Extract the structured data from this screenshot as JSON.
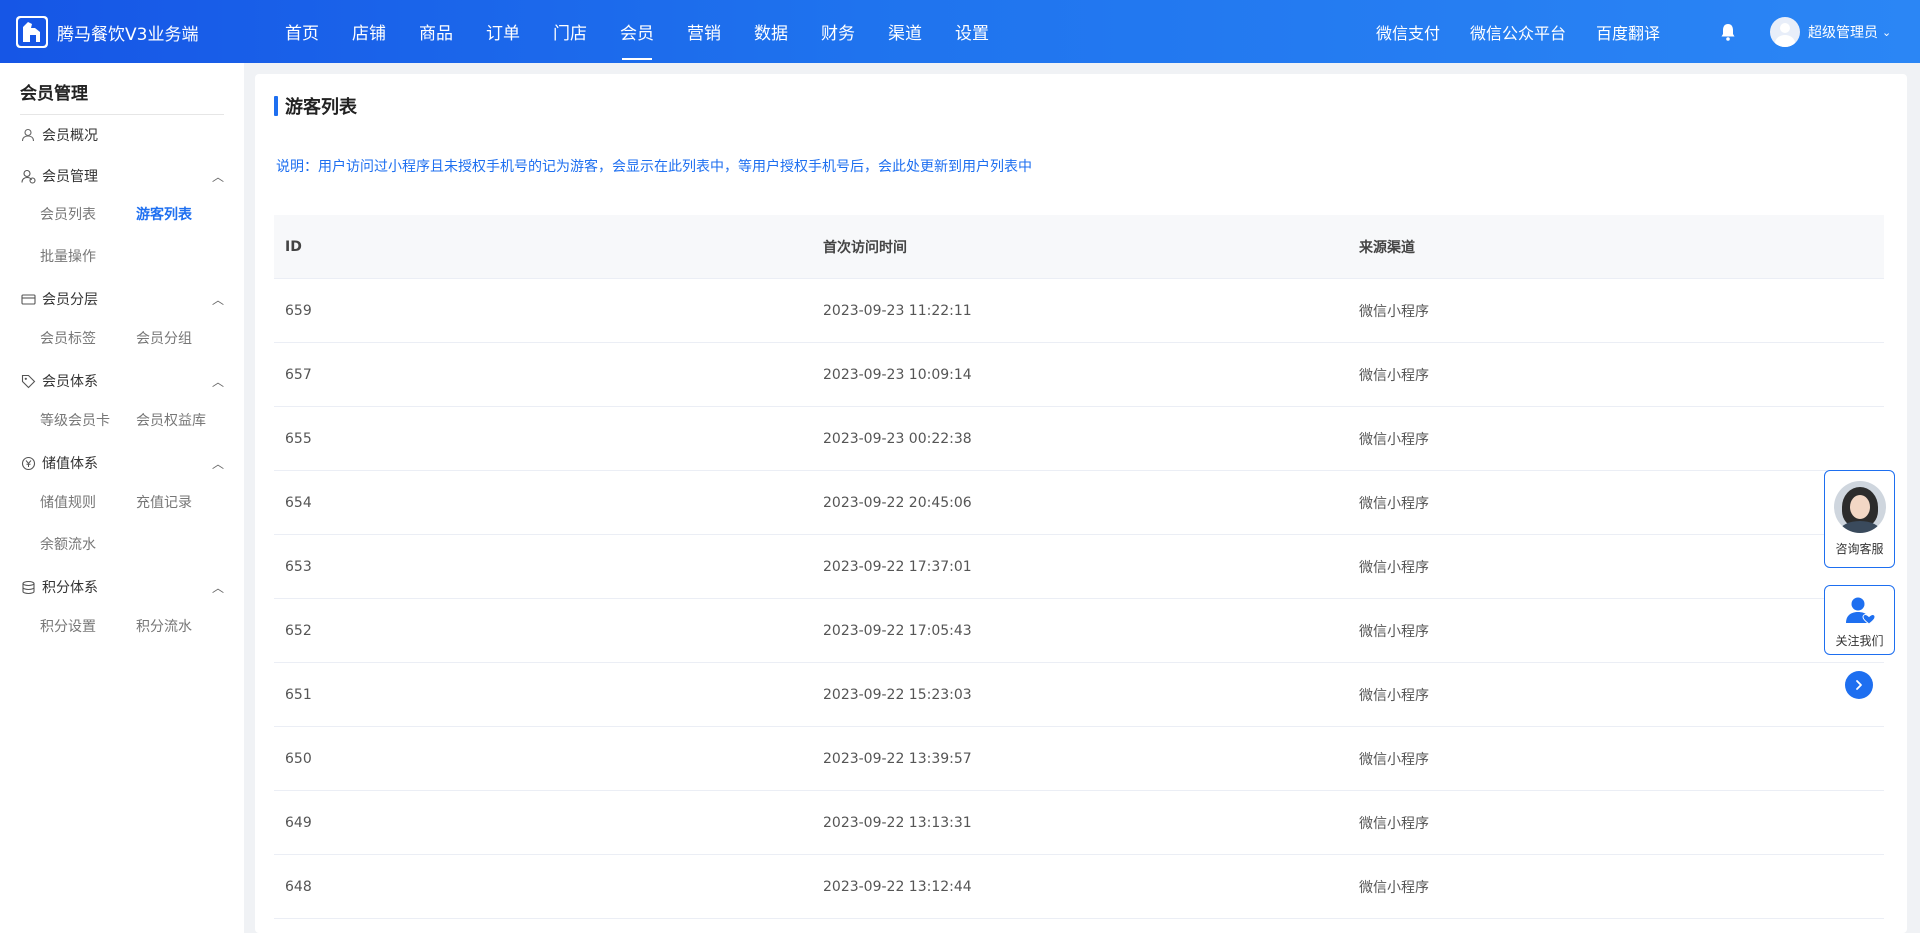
{
  "brand": {
    "name": "腾马餐饮V3业务端",
    "logo_icon": "horse-logo-icon"
  },
  "topnav": {
    "items": [
      {
        "label": "首页",
        "active": false
      },
      {
        "label": "店铺",
        "active": false
      },
      {
        "label": "商品",
        "active": false
      },
      {
        "label": "订单",
        "active": false
      },
      {
        "label": "门店",
        "active": false
      },
      {
        "label": "会员",
        "active": true
      },
      {
        "label": "营销",
        "active": false
      },
      {
        "label": "数据",
        "active": false
      },
      {
        "label": "财务",
        "active": false
      },
      {
        "label": "渠道",
        "active": false
      },
      {
        "label": "设置",
        "active": false
      }
    ],
    "right_links": [
      "微信支付",
      "微信公众平台",
      "百度翻译"
    ],
    "user": {
      "name": "超级管理员",
      "caret": "⌄"
    }
  },
  "sidebar": {
    "title": "会员管理",
    "overview": "会员概况",
    "sections": [
      {
        "label": "会员管理",
        "icon": "member-manage-icon",
        "items": [
          "会员列表",
          "游客列表",
          "批量操作"
        ]
      },
      {
        "label": "会员分层",
        "icon": "card-icon",
        "items": [
          "会员标签",
          "会员分组"
        ]
      },
      {
        "label": "会员体系",
        "icon": "tag-icon",
        "items": [
          "等级会员卡",
          "会员权益库"
        ]
      },
      {
        "label": "储值体系",
        "icon": "yen-circle-icon",
        "items": [
          "储值规则",
          "充值记录",
          "余额流水"
        ]
      },
      {
        "label": "积分体系",
        "icon": "coins-icon",
        "items": [
          "积分设置",
          "积分流水"
        ]
      }
    ],
    "active_item": "游客列表"
  },
  "page": {
    "title": "游客列表",
    "notice": "说明：用户访问过小程序且未授权手机号的记为游客，会显示在此列表中，等用户授权手机号后，会此处更新到用户列表中"
  },
  "table": {
    "columns": [
      "ID",
      "首次访问时间",
      "来源渠道"
    ],
    "rows": [
      [
        "659",
        "2023-09-23 11:22:11",
        "微信小程序"
      ],
      [
        "657",
        "2023-09-23 10:09:14",
        "微信小程序"
      ],
      [
        "655",
        "2023-09-23 00:22:38",
        "微信小程序"
      ],
      [
        "654",
        "2023-09-22 20:45:06",
        "微信小程序"
      ],
      [
        "653",
        "2023-09-22 17:37:01",
        "微信小程序"
      ],
      [
        "652",
        "2023-09-22 17:05:43",
        "微信小程序"
      ],
      [
        "651",
        "2023-09-22 15:23:03",
        "微信小程序"
      ],
      [
        "650",
        "2023-09-22 13:39:57",
        "微信小程序"
      ],
      [
        "649",
        "2023-09-22 13:13:31",
        "微信小程序"
      ],
      [
        "648",
        "2023-09-22 13:12:44",
        "微信小程序"
      ]
    ]
  },
  "float": {
    "consult_label": "咨询客服",
    "follow_label": "关注我们",
    "next_icon": "chevron-right-icon"
  },
  "colors": {
    "primary": "#1e6ff0",
    "topbar_start": "#1656e6",
    "topbar_end": "#2b86f5"
  }
}
